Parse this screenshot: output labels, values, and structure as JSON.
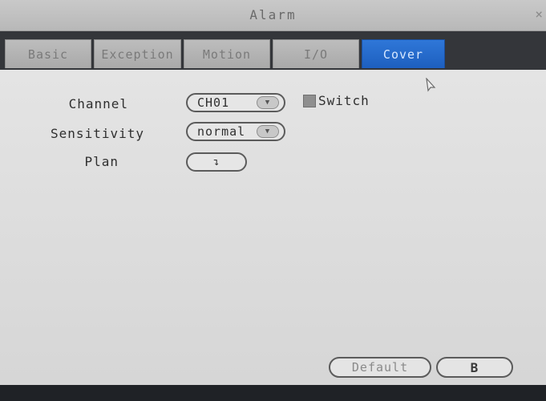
{
  "window": {
    "title": "Alarm",
    "close_glyph": "×"
  },
  "tabs": [
    {
      "label": "Basic",
      "active": false
    },
    {
      "label": "Exception",
      "active": false
    },
    {
      "label": "Motion",
      "active": false
    },
    {
      "label": "I/O",
      "active": false
    },
    {
      "label": "Cover",
      "active": true
    }
  ],
  "form": {
    "channel": {
      "label": "Channel",
      "value": "CH01"
    },
    "switch": {
      "label": "Switch",
      "checked": false
    },
    "sensitivity": {
      "label": "Sensitivity",
      "value": "normal"
    },
    "plan": {
      "label": "Plan",
      "button_glyph": "↴"
    }
  },
  "footer": {
    "default_label": "Default",
    "save_glyph": "B"
  },
  "colors": {
    "active_tab": "#1d5fbf",
    "background": "#d9d9d9"
  },
  "icons": {
    "dropdown": "chevron-down-icon",
    "save": "save-icon",
    "cursor": "mouse-cursor-icon"
  }
}
